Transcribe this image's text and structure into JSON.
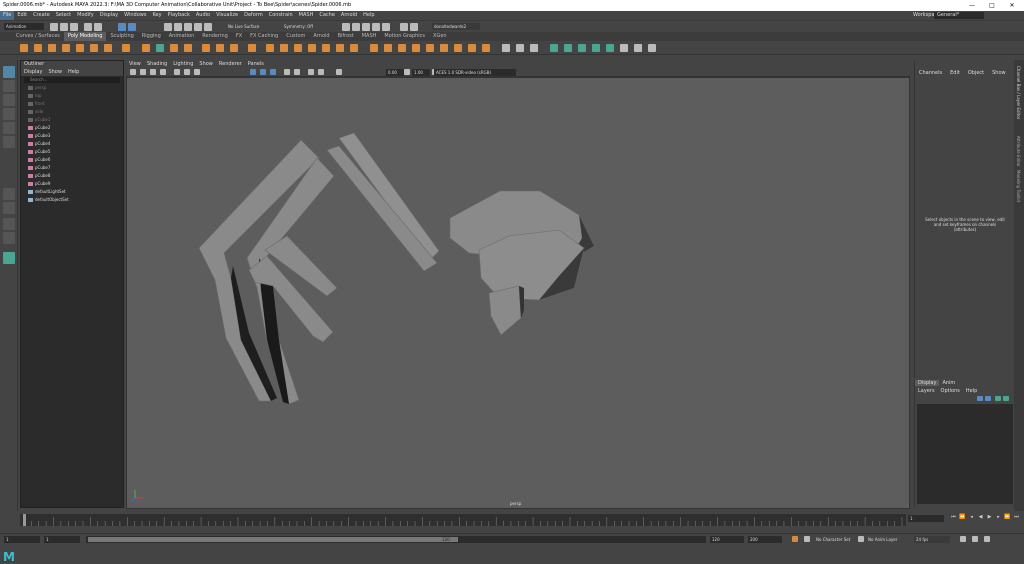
{
  "window": {
    "title": "Spider.0006.mb* - Autodesk MAYA 2022.3: F:\\MA 3D Computer Animation\\Collaborative Unit\\Project - To Bee\\Spider\\scenes\\Spider.0006.mb",
    "minimize": "—",
    "maximize": "□",
    "close": "✕"
  },
  "menubar": {
    "items": [
      "File",
      "Edit",
      "Create",
      "Select",
      "Modify",
      "Display",
      "Windows",
      "Key",
      "Playback",
      "Audio",
      "Visualize",
      "Deform",
      "Constrain",
      "MASH",
      "Cache",
      "Arnold",
      "Help"
    ],
    "workspace_label": "Workspace :",
    "workspace_value": "General*"
  },
  "statusline": {
    "menu_set": "Animation",
    "live_surface": "No Live Surface",
    "symmetry": "Symmetry: Off",
    "user": "donaltedwards2"
  },
  "shelf": {
    "tabs": [
      "Curves / Surfaces",
      "Poly Modeling",
      "Sculpting",
      "Rigging",
      "Animation",
      "Rendering",
      "FX",
      "FX Caching",
      "Custom",
      "Arnold",
      "Bifrost",
      "MASH",
      "Motion Graphics",
      "XGen"
    ],
    "active_tab": "Poly Modeling"
  },
  "outliner": {
    "title": "Outliner",
    "menu": [
      "Display",
      "Show",
      "Help"
    ],
    "search_placeholder": "Search...",
    "rows": [
      {
        "label": "persp",
        "dim": true
      },
      {
        "label": "top",
        "dim": true
      },
      {
        "label": "front",
        "dim": true
      },
      {
        "label": "side",
        "dim": true
      },
      {
        "label": "pCube1",
        "dim": true
      },
      {
        "label": "pCube2",
        "dim": false
      },
      {
        "label": "pCube3",
        "dim": false
      },
      {
        "label": "pCube4",
        "dim": false
      },
      {
        "label": "pCube5",
        "dim": false
      },
      {
        "label": "pCube6",
        "dim": false
      },
      {
        "label": "pCube7",
        "dim": false
      },
      {
        "label": "pCube8",
        "dim": false
      },
      {
        "label": "pCube9",
        "dim": false
      },
      {
        "label": "defaultLightSet",
        "dim": false
      },
      {
        "label": "defaultObjectSet",
        "dim": false
      }
    ]
  },
  "viewport": {
    "menu": [
      "View",
      "Shading",
      "Lighting",
      "Show",
      "Renderer",
      "Panels"
    ],
    "near_value": "0.00",
    "far_value": "1.00",
    "color_space": "ACES 1.0 SDR-video (sRGB)",
    "camera_label": "persp"
  },
  "channel_box": {
    "menu": [
      "Channels",
      "Edit",
      "Object",
      "Show"
    ],
    "message": "Select objects in the scene to view, edit and set keyframes on channels (attributes)"
  },
  "layer_editor": {
    "tabs": [
      "Display",
      "Anim"
    ],
    "active_tab": "Display",
    "menu": [
      "Layers",
      "Options",
      "Help"
    ]
  },
  "side_tabs": [
    "Channel Box / Layer Editor",
    "Attribute Editor",
    "Modeling Toolkit"
  ],
  "timeline": {
    "current_frame": "1",
    "range_start": "1",
    "range_start_inner": "1",
    "range_end_inner": "120",
    "range_end": "120",
    "anim_end": "200",
    "character_set": "No Character Set",
    "anim_layer": "No Anim Layer",
    "fps": "24 fps"
  },
  "colors": {
    "viewport_bg": "#5d5d5d",
    "model_fill": "#8a8a8a",
    "accent": "#4a6c8c",
    "shelf_orange": "#d98b3a",
    "shelf_green": "#4aa690"
  }
}
